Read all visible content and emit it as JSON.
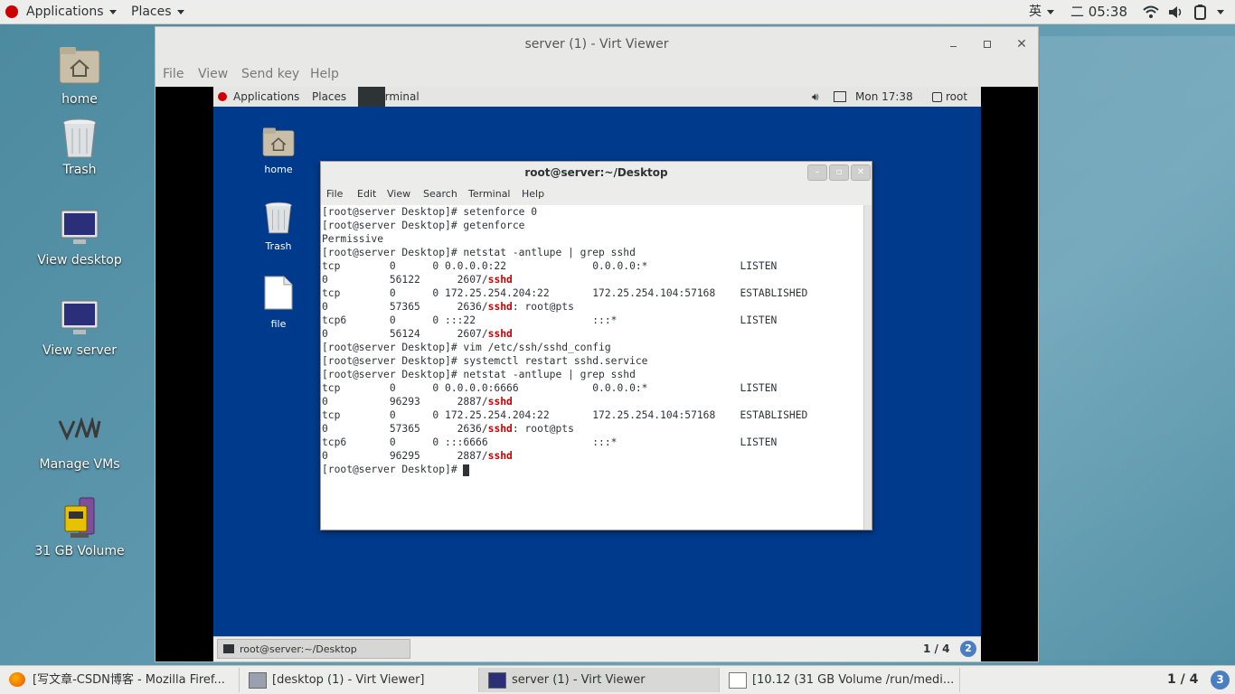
{
  "host_topbar": {
    "applications": "Applications",
    "places": "Places",
    "input_method": "英",
    "clock": "二 05:38"
  },
  "host_desktop": {
    "icons": [
      {
        "label": "home"
      },
      {
        "label": "Trash"
      },
      {
        "label": "View desktop"
      },
      {
        "label": "View server"
      },
      {
        "label": "Manage VMs"
      },
      {
        "label": "31 GB Volume"
      }
    ]
  },
  "virt_viewer": {
    "title": "server (1) - Virt Viewer",
    "menu": [
      "File",
      "View",
      "Send key",
      "Help"
    ]
  },
  "guest_topbar": {
    "applications": "Applications",
    "places": "Places",
    "terminal": "Terminal",
    "clock": "Mon 17:38",
    "user": "root"
  },
  "guest_desktop": {
    "icons": [
      {
        "label": "home"
      },
      {
        "label": "Trash"
      },
      {
        "label": "file"
      }
    ]
  },
  "terminal": {
    "title": "root@server:~/Desktop",
    "menu": [
      "File",
      "Edit",
      "View",
      "Search",
      "Terminal",
      "Help"
    ],
    "lines": [
      {
        "text": "[root@server Desktop]# setenforce 0"
      },
      {
        "text": "[root@server Desktop]# getenforce"
      },
      {
        "text": "Permissive"
      },
      {
        "text": "[root@server Desktop]# netstat -antlupe | grep sshd"
      },
      {
        "text": "tcp        0      0 0.0.0.0:22              0.0.0.0:*               LISTEN"
      },
      {
        "text": "0          56122      2607/",
        "red": "sshd",
        "after": ""
      },
      {
        "text": "tcp        0      0 172.25.254.204:22       172.25.254.104:57168    ESTABLISHED"
      },
      {
        "text": "0          57365      2636/",
        "red": "sshd",
        "after": ": root@pts"
      },
      {
        "text": "tcp6       0      0 :::22                   :::*                    LISTEN"
      },
      {
        "text": "0          56124      2607/",
        "red": "sshd",
        "after": ""
      },
      {
        "text": "[root@server Desktop]# vim /etc/ssh/sshd_config"
      },
      {
        "text": "[root@server Desktop]# systemctl restart sshd.service"
      },
      {
        "text": "[root@server Desktop]# netstat -antlupe | grep sshd"
      },
      {
        "text": "tcp        0      0 0.0.0.0:6666            0.0.0.0:*               LISTEN"
      },
      {
        "text": "0          96293      2887/",
        "red": "sshd",
        "after": ""
      },
      {
        "text": "tcp        0      0 172.25.254.204:22       172.25.254.104:57168    ESTABLISHED"
      },
      {
        "text": "0          57365      2636/",
        "red": "sshd",
        "after": ": root@pts"
      },
      {
        "text": "tcp6       0      0 :::6666                 :::*                    LISTEN"
      },
      {
        "text": "0          96295      2887/",
        "red": "sshd",
        "after": ""
      },
      {
        "text": "[root@server Desktop]# "
      }
    ]
  },
  "guest_taskbar": {
    "task": "root@server:~/Desktop",
    "workspace": "1 / 4",
    "badge": "2"
  },
  "host_taskbar": {
    "tasks": [
      {
        "label": "[写文章-CSDN博客 - Mozilla Firef..."
      },
      {
        "label": "[desktop (1) - Virt Viewer]"
      },
      {
        "label": "server (1) - Virt Viewer"
      },
      {
        "label": "[10.12 (31 GB Volume /run/medi..."
      }
    ],
    "workspace": "1 / 4",
    "badge": "3"
  },
  "colors": {
    "guest_background": "#003a8c",
    "terminal_highlight": "#cc0000"
  }
}
